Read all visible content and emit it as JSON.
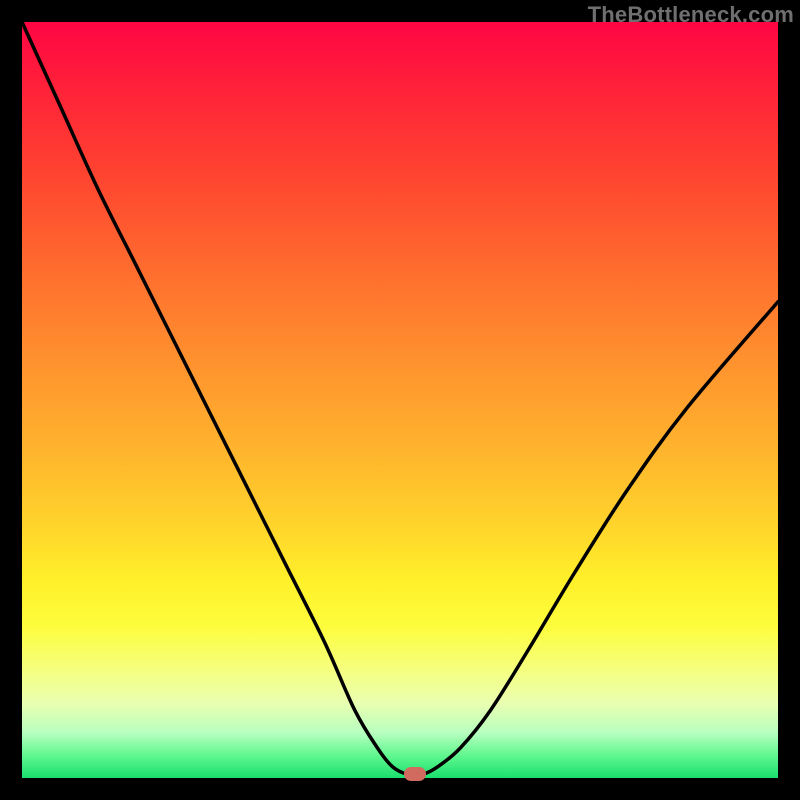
{
  "watermark": "TheBottleneck.com",
  "colors": {
    "frame": "#000000",
    "curve": "#000000",
    "marker": "#d16a5f",
    "gradient_top": "#ff0543",
    "gradient_bottom": "#19e06e"
  },
  "chart_data": {
    "type": "line",
    "title": "",
    "xlabel": "",
    "ylabel": "",
    "xlim": [
      0,
      100
    ],
    "ylim": [
      0,
      100
    ],
    "grid": false,
    "legend": false,
    "series": [
      {
        "name": "bottleneck-curve",
        "x": [
          0,
          5,
          10,
          15,
          20,
          25,
          30,
          35,
          40,
          44,
          47,
          49,
          51,
          53,
          55,
          58,
          62,
          67,
          73,
          80,
          88,
          100
        ],
        "y": [
          100,
          89,
          78,
          68,
          58,
          48,
          38,
          28,
          18,
          9,
          4,
          1.5,
          0.5,
          0.5,
          1.5,
          4,
          9,
          17,
          27,
          38,
          49,
          63
        ]
      }
    ],
    "annotations": [
      {
        "name": "minimum-marker",
        "x": 52,
        "y": 0.5
      }
    ]
  }
}
